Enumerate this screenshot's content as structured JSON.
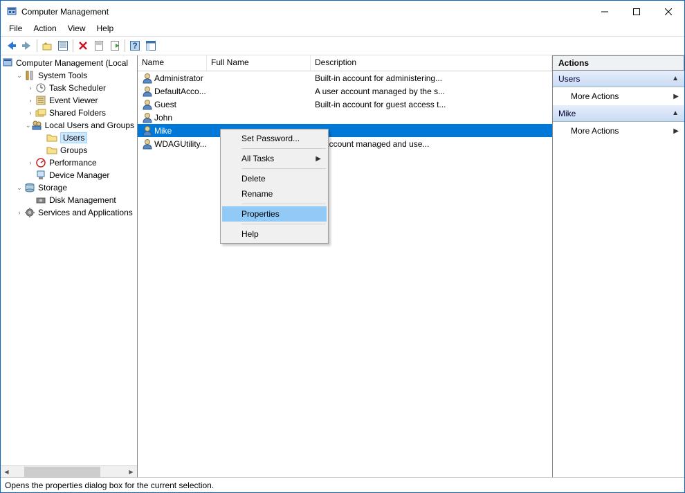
{
  "window": {
    "title": "Computer Management"
  },
  "menu": [
    "File",
    "Action",
    "View",
    "Help"
  ],
  "tree": {
    "root": "Computer Management (Local",
    "nodes": [
      {
        "indent": 1,
        "exp": "open",
        "icon": "tools",
        "label": "System Tools"
      },
      {
        "indent": 2,
        "exp": "closed",
        "icon": "clock",
        "label": "Task Scheduler"
      },
      {
        "indent": 2,
        "exp": "closed",
        "icon": "event",
        "label": "Event Viewer"
      },
      {
        "indent": 2,
        "exp": "closed",
        "icon": "folders",
        "label": "Shared Folders"
      },
      {
        "indent": 2,
        "exp": "open",
        "icon": "users-icon",
        "label": "Local Users and Groups"
      },
      {
        "indent": 3,
        "exp": "none",
        "icon": "folder",
        "label": "Users",
        "selected": true
      },
      {
        "indent": 3,
        "exp": "none",
        "icon": "folder",
        "label": "Groups"
      },
      {
        "indent": 2,
        "exp": "closed",
        "icon": "perf",
        "label": "Performance"
      },
      {
        "indent": 2,
        "exp": "none",
        "icon": "device",
        "label": "Device Manager"
      },
      {
        "indent": 1,
        "exp": "open",
        "icon": "storage",
        "label": "Storage"
      },
      {
        "indent": 2,
        "exp": "none",
        "icon": "disk",
        "label": "Disk Management"
      },
      {
        "indent": 1,
        "exp": "closed",
        "icon": "services",
        "label": "Services and Applications"
      }
    ]
  },
  "columns": {
    "name": "Name",
    "full": "Full Name",
    "desc": "Description"
  },
  "users": [
    {
      "name": "Administrator",
      "full": "",
      "desc": "Built-in account for administering..."
    },
    {
      "name": "DefaultAcco...",
      "full": "",
      "desc": "A user account managed by the s..."
    },
    {
      "name": "Guest",
      "full": "",
      "desc": "Built-in account for guest access t..."
    },
    {
      "name": "John",
      "full": "",
      "desc": ""
    },
    {
      "name": "Mike",
      "full": "",
      "desc": "",
      "selected": true
    },
    {
      "name": "WDAGUtility...",
      "full": "",
      "desc": "er account managed and use..."
    }
  ],
  "context_menu": {
    "items": [
      {
        "label": "Set Password...",
        "sep_after": true
      },
      {
        "label": "All Tasks",
        "submenu": true,
        "sep_after": true
      },
      {
        "label": "Delete"
      },
      {
        "label": "Rename",
        "sep_after": true
      },
      {
        "label": "Properties",
        "highlighted": true,
        "sep_after": true
      },
      {
        "label": "Help"
      }
    ]
  },
  "actions": {
    "header": "Actions",
    "sections": [
      {
        "title": "Users",
        "items": [
          {
            "label": "More Actions",
            "arrow": true
          }
        ]
      },
      {
        "title": "Mike",
        "items": [
          {
            "label": "More Actions",
            "arrow": true
          }
        ]
      }
    ]
  },
  "statusbar": "Opens the properties dialog box for the current selection."
}
